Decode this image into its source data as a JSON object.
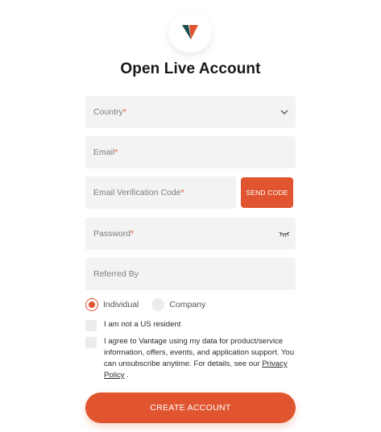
{
  "brand": {
    "logo_icon": "vantage-v-logo",
    "colors": {
      "accent": "#e0552f",
      "dark": "#1f4e4f"
    }
  },
  "title": "Open Live Account",
  "fields": {
    "country": {
      "placeholder": "Country",
      "required_mark": "*"
    },
    "email": {
      "placeholder": "Email",
      "required_mark": "*"
    },
    "verification_code": {
      "placeholder": "Email Verification Code",
      "required_mark": "*"
    },
    "password": {
      "placeholder": "Password",
      "required_mark": "*"
    },
    "referred_by": {
      "placeholder": "Referred By"
    }
  },
  "send_code_label": "SEND CODE",
  "account_type": {
    "options": [
      "Individual",
      "Company"
    ],
    "selected": "Individual"
  },
  "checkboxes": {
    "not_us_resident": "I am not a US resident",
    "agree_prefix": "I agree to Vantage using my data for product/service information, offers, events, and application support. You can unsubscribe anytime. For details, see our ",
    "privacy_link": "Privacy Policy",
    "agree_suffix": " ."
  },
  "create_button": "CREATE ACCOUNT"
}
